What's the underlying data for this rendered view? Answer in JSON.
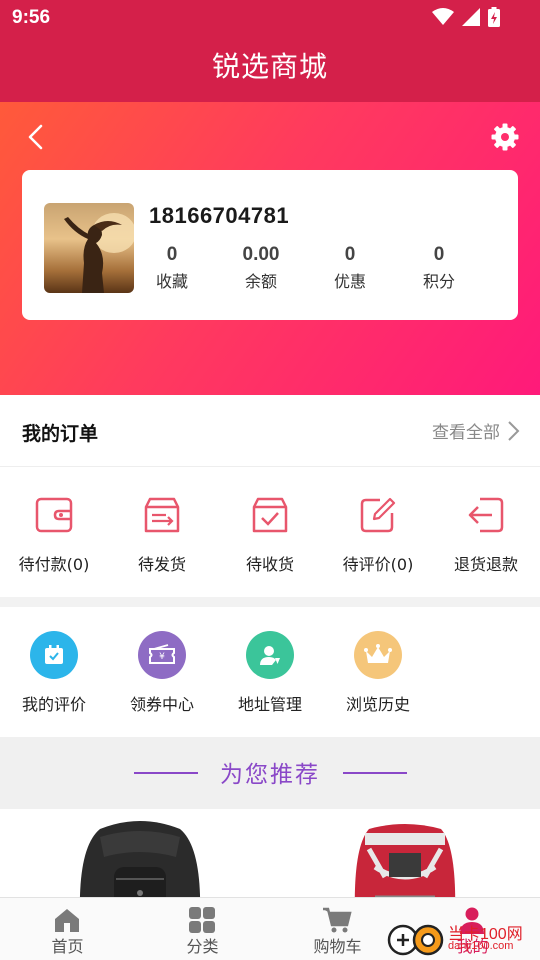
{
  "status_bar": {
    "time": "9:56"
  },
  "app_bar": {
    "title": "锐选商城"
  },
  "profile": {
    "phone": "18166704781",
    "stats": [
      {
        "value": "0",
        "label": "收藏"
      },
      {
        "value": "0.00",
        "label": "余额"
      },
      {
        "value": "0",
        "label": "优惠"
      },
      {
        "value": "0",
        "label": "积分"
      }
    ]
  },
  "orders": {
    "title": "我的订单",
    "view_all": "查看全部",
    "items": [
      {
        "label": "待付款(0)",
        "icon": "wallet-icon"
      },
      {
        "label": "待发货",
        "icon": "shipping-box-icon"
      },
      {
        "label": "待收货",
        "icon": "receive-box-icon"
      },
      {
        "label": "待评价(0)",
        "icon": "edit-review-icon"
      },
      {
        "label": "退货退款",
        "icon": "return-icon"
      }
    ]
  },
  "tools": {
    "items": [
      {
        "label": "我的评价",
        "icon": "calendar-check-icon",
        "color": "#2cb5ea"
      },
      {
        "label": "领券中心",
        "icon": "coupon-icon",
        "color": "#8e6cc4"
      },
      {
        "label": "地址管理",
        "icon": "user-pin-icon",
        "color": "#3bc59a"
      },
      {
        "label": "浏览历史",
        "icon": "crown-icon",
        "color": "#f5c67a"
      }
    ]
  },
  "recommend": {
    "title": "为您推荐"
  },
  "tabbar": {
    "tabs": [
      {
        "label": "首页",
        "icon": "home-icon"
      },
      {
        "label": "分类",
        "icon": "grid-icon"
      },
      {
        "label": "购物车",
        "icon": "cart-icon"
      },
      {
        "label": "我的",
        "icon": "user-icon"
      }
    ]
  },
  "watermark": {
    "text": "当卡100网",
    "url": "danji100.com"
  },
  "colors": {
    "brand": "#d4204a",
    "accent_purple": "#8a48c8",
    "order_icon": "#e8566c",
    "tab_active": "#d81e5b"
  }
}
